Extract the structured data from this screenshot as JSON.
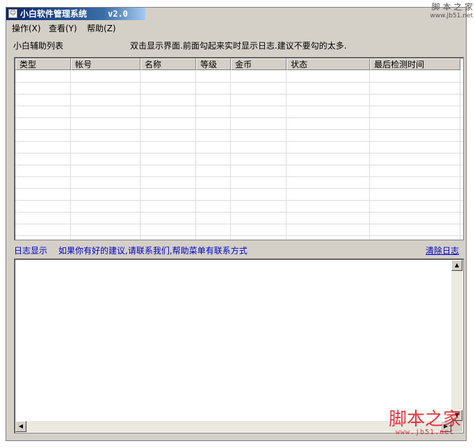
{
  "window": {
    "title": "小白软件管理系统",
    "version": "v2.0"
  },
  "menu": {
    "items": [
      {
        "label": "操作(X)"
      },
      {
        "label": "查看(Y)"
      },
      {
        "label": "帮助(Z)"
      }
    ]
  },
  "list": {
    "heading": "小白辅助列表",
    "hint": "双击显示界面.前面勾起来实时显示日志.建议不要勾的太多.",
    "columns": [
      "类型",
      "帐号",
      "名称",
      "等级",
      "金币",
      "状态",
      "最后检测时间"
    ],
    "rows": []
  },
  "log": {
    "label": "日志显示",
    "hint": "如果你有好的建议,请联系我们,帮助菜单有联系方式",
    "clear_label": "清除日志",
    "content": ""
  },
  "watermark": {
    "top_text": "脚 本 之 家",
    "top_url": "www.Jb51.net",
    "bottom_text": "脚本之家",
    "bottom_url": "www.jb51.net"
  }
}
